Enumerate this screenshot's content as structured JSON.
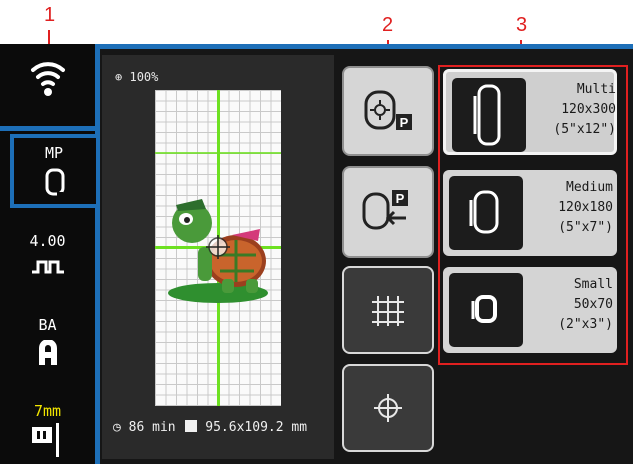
{
  "callouts": {
    "c1": "1",
    "c2": "2",
    "c3": "3"
  },
  "sidebar": {
    "wifi_icon": "wifi-icon",
    "hoop_mode": "MP",
    "stitch_length": "4.00",
    "presser_foot": "BA",
    "needle_width": "7mm"
  },
  "preview": {
    "zoom": "100%",
    "time": "86 min",
    "size": "95.6x109.2 mm"
  },
  "middle_buttons": [
    "hoop-position-p-icon",
    "return-to-p-icon",
    "grid-icon",
    "center-crosshair-icon"
  ],
  "hoops": [
    {
      "name": "Multi",
      "dims": "120x300",
      "inches": "(5\"x12\")",
      "selected": true
    },
    {
      "name": "Medium",
      "dims": "120x180",
      "inches": "(5\"x7\")",
      "selected": false
    },
    {
      "name": "Small",
      "dims": "50x70",
      "inches": "(2\"x3\")",
      "selected": false
    }
  ],
  "colors": {
    "accent_blue": "#1d6fb8",
    "callout_red": "#e02020",
    "needle_yellow": "#f2e600",
    "crosshair_green": "#6de021"
  }
}
